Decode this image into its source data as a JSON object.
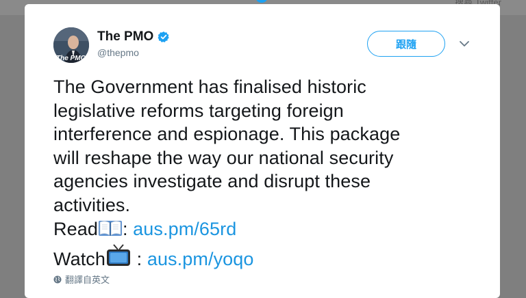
{
  "background": {
    "top_right_text": "搜尋 Twitter"
  },
  "tweet": {
    "author_name": "The PMO",
    "author_handle": "@thepmo",
    "avatar_label": "The PMO",
    "follow_label": "跟隨",
    "text_lines": [
      "The Government has finalised historic",
      "legislative reforms targeting foreign",
      "interference and espionage. This package",
      "will reshape the way our national security",
      "agencies investigate and disrupt these",
      "activities."
    ],
    "read_prefix": "Read",
    "read_sep": ": ",
    "read_link": "aus.pm/65rd",
    "watch_prefix": "Watch",
    "watch_sep": " : ",
    "watch_link": "aus.pm/yoqo",
    "translate_label": "翻譯自英文"
  },
  "colors": {
    "accent": "#1da1f2",
    "link": "#1b95e0",
    "overlay": "#7f7f7f"
  },
  "icons": [
    "verified-badge-icon",
    "chevron-down-icon",
    "book-emoji-icon",
    "tv-emoji-icon",
    "globe-icon"
  ]
}
